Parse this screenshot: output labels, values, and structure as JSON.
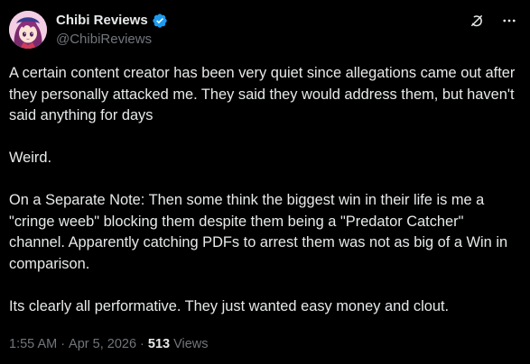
{
  "post": {
    "author": {
      "display_name": "Chibi Reviews",
      "handle": "@ChibiReviews",
      "verified": true,
      "avatar_icon": "anime-chibi-avatar"
    },
    "body": [
      "A certain content creator has been very quiet since allegations came out after they personally attacked me. They said they would address them, but haven't said anything for days",
      "Weird.",
      "On a Separate Note: Then some think the biggest win in their life is me a \"cringe weeb\" blocking them despite them being a \"Predator Catcher\" channel. Apparently catching PDFs to arrest them was not as big of a Win in comparison.",
      "Its clearly all performative. They just wanted easy money and clout."
    ],
    "meta": {
      "time": "1:55 AM",
      "separator": "·",
      "date": "Apr 5, 2026",
      "views_count": "513",
      "views_label": "Views"
    },
    "icons": {
      "grok": "grok-icon",
      "more": "more-options-icon",
      "verified": "verified-badge-icon"
    },
    "colors": {
      "background": "#000000",
      "text": "#e7e9ea",
      "secondary_text": "#71767b",
      "verified_blue": "#1d9bf0"
    }
  }
}
